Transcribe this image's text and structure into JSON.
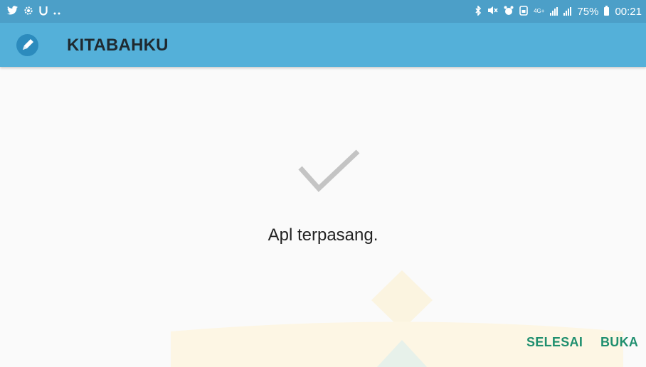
{
  "status_bar": {
    "left_icons": [
      "twitter-icon",
      "settings-icon",
      "u-icon",
      "more-dots-icon"
    ],
    "network_label": "4G+",
    "battery": "75%",
    "time": "00:21"
  },
  "app_bar": {
    "icon": "pencil-icon",
    "title": "KITABAHKU"
  },
  "main": {
    "status_icon": "checkmark-icon",
    "message": "Apl terpasang."
  },
  "actions": {
    "done_label": "SELESAI",
    "open_label": "BUKA"
  },
  "colors": {
    "status_bar": "#4c9fc8",
    "app_bar": "#54b0d9",
    "accent_text": "#1f8f6f",
    "check": "#c4c4c4"
  }
}
